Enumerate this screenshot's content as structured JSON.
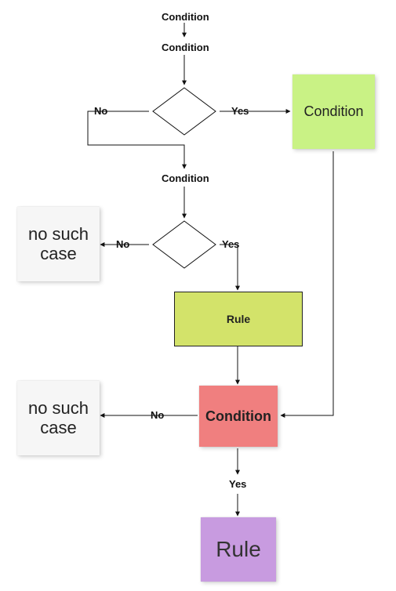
{
  "labels": {
    "condition_top": "Condition",
    "condition_second": "Condition",
    "condition_third": "Condition",
    "no1": "No",
    "yes1": "Yes",
    "no2": "No",
    "yes2": "Yes",
    "no3": "No",
    "yes3": "Yes"
  },
  "sticky": {
    "green_condition": "Condition",
    "no_such_case_1": "no such case",
    "rule_box": "Rule",
    "red_condition": "Condition",
    "no_such_case_2": "no such case",
    "purple_rule": "Rule"
  },
  "flow": {
    "type": "decision-flow",
    "nodes": [
      {
        "id": "c1",
        "type": "text",
        "text": "Condition"
      },
      {
        "id": "c2",
        "type": "text",
        "text": "Condition"
      },
      {
        "id": "d1",
        "type": "decision"
      },
      {
        "id": "g1",
        "type": "sticky",
        "text": "Condition",
        "color": "green"
      },
      {
        "id": "c3",
        "type": "text",
        "text": "Condition"
      },
      {
        "id": "d2",
        "type": "decision"
      },
      {
        "id": "n1",
        "type": "sticky",
        "text": "no such case",
        "color": "grey"
      },
      {
        "id": "r1",
        "type": "process",
        "text": "Rule",
        "color": "yellow"
      },
      {
        "id": "rc",
        "type": "sticky",
        "text": "Condition",
        "color": "red"
      },
      {
        "id": "n2",
        "type": "sticky",
        "text": "no such case",
        "color": "grey"
      },
      {
        "id": "pr",
        "type": "sticky",
        "text": "Rule",
        "color": "purple"
      }
    ],
    "edges": [
      {
        "from": "c1",
        "to": "c2"
      },
      {
        "from": "c2",
        "to": "d1"
      },
      {
        "from": "d1",
        "to": "g1",
        "label": "Yes"
      },
      {
        "from": "d1",
        "to": "c3",
        "label": "No"
      },
      {
        "from": "c3",
        "to": "d2"
      },
      {
        "from": "d2",
        "to": "n1",
        "label": "No"
      },
      {
        "from": "d2",
        "to": "r1",
        "label": "Yes"
      },
      {
        "from": "r1",
        "to": "rc"
      },
      {
        "from": "g1",
        "to": "rc"
      },
      {
        "from": "rc",
        "to": "n2",
        "label": "No"
      },
      {
        "from": "rc",
        "to": "pr",
        "label": "Yes"
      }
    ]
  }
}
